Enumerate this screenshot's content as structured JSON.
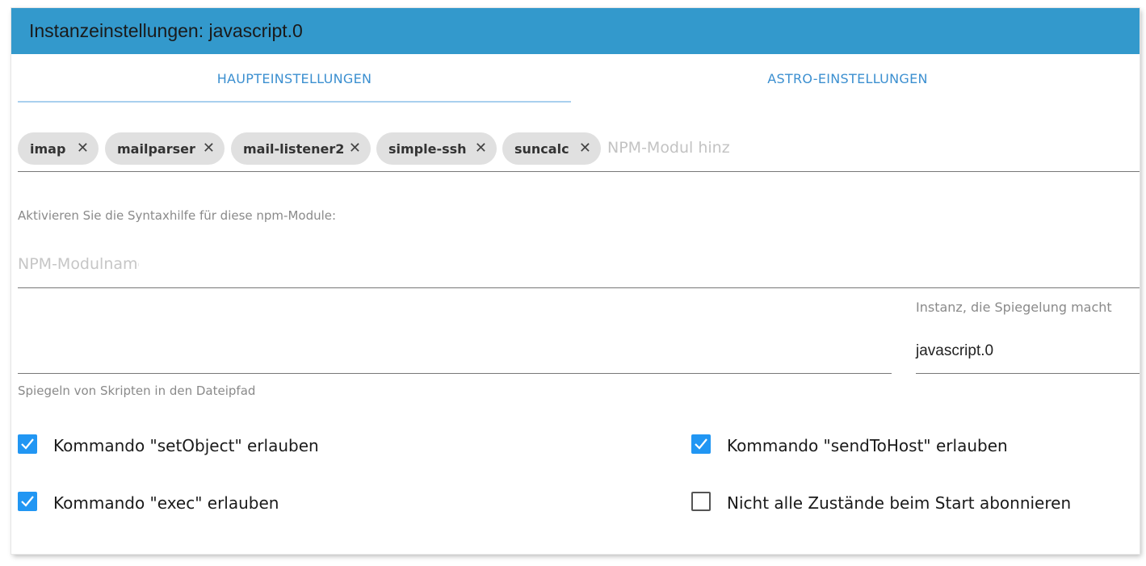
{
  "window": {
    "title": "Instanzeinstellungen: javascript.0",
    "accent": "#3399cc"
  },
  "tabs": [
    {
      "label": "HAUPTEINSTELLUNGEN",
      "active": true
    },
    {
      "label": "ASTRO-EINSTELLUNGEN",
      "active": false
    }
  ],
  "npm_modules": {
    "chips": [
      "imap",
      "mailparser",
      "mail-listener2",
      "simple-ssh",
      "suncalc"
    ],
    "add_placeholder": "NPM-Modul hinzufügen"
  },
  "syntax_help": {
    "label": "Aktivieren Sie die Syntaxhilfe für diese npm-Module:",
    "placeholder": "NPM-Modulname"
  },
  "mirror": {
    "path_value": "",
    "path_helper": "Spiegeln von Skripten in den Dateipfad",
    "instance_label": "Instanz, die Spiegelung macht",
    "instance_value": "javascript.0"
  },
  "options": [
    {
      "label": "Kommando \"setObject\" erlauben",
      "checked": true
    },
    {
      "label": "Kommando \"sendToHost\" erlauben",
      "checked": true
    },
    {
      "label": "Kommando \"exec\" erlauben",
      "checked": true
    },
    {
      "label": "Nicht alle Zustände beim Start abonnieren",
      "checked": false
    }
  ],
  "colors": {
    "checkbox_checked": "#2196f3",
    "tab_text": "#3b8fd0"
  }
}
